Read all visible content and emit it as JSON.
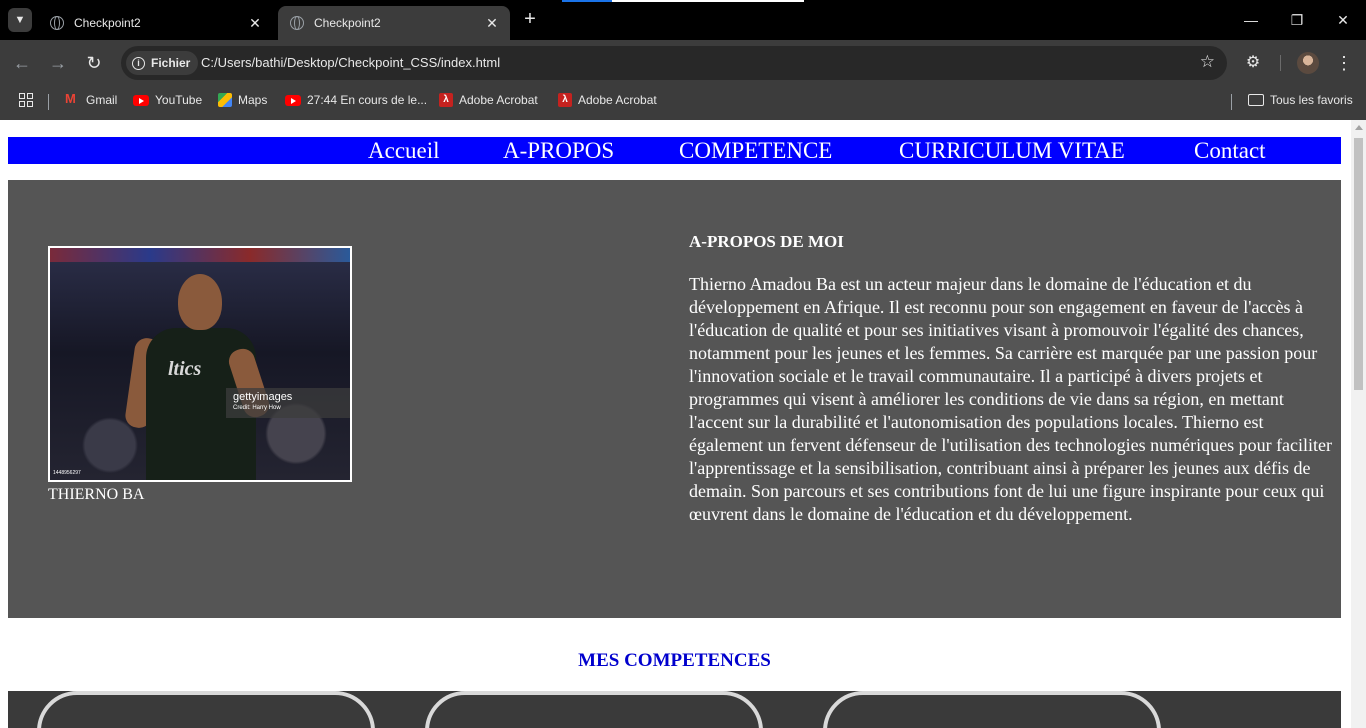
{
  "browser": {
    "tabs": [
      {
        "title": "Checkpoint2"
      },
      {
        "title": "Checkpoint2"
      }
    ],
    "site_chip": "Fichier",
    "url": "C:/Users/bathi/Desktop/Checkpoint_CSS/index.html",
    "bookmarks": [
      {
        "label": "Gmail"
      },
      {
        "label": "YouTube"
      },
      {
        "label": "Maps"
      },
      {
        "label": "27:44 En cours de le..."
      },
      {
        "label": "Adobe Acrobat"
      },
      {
        "label": "Adobe Acrobat"
      }
    ],
    "all_bookmarks": "Tous les favoris"
  },
  "page": {
    "nav": [
      "Accueil",
      "A-PROPOS",
      "COMPETENCE",
      "CURRICULUM VITAE",
      "Contact"
    ],
    "about": {
      "photo_watermark": "gettyimages",
      "photo_credit": "Credit: Harry How",
      "photo_id": "1448956297",
      "jersey_text": "ltics",
      "caption": "THIERNO BA",
      "heading": "A-PROPOS DE MOI",
      "text": "Thierno Amadou Ba est un acteur majeur dans le domaine de l'éducation et du développement en Afrique. Il est reconnu pour son engagement en faveur de l'accès à l'éducation de qualité et pour ses initiatives visant à promouvoir l'égalité des chances, notamment pour les jeunes et les femmes. Sa carrière est marquée par une passion pour l'innovation sociale et le travail communautaire. Il a participé à divers projets et programmes qui visent à améliorer les conditions de vie dans sa région, en mettant l'accent sur la durabilité et l'autonomisation des populations locales. Thierno est également un fervent défenseur de l'utilisation des technologies numériques pour faciliter l'apprentissage et la sensibilisation, contribuant ainsi à préparer les jeunes aux défis de demain. Son parcours et ses contributions font de lui une figure inspirante pour ceux qui œuvrent dans le domaine de l'éducation et du développement."
    },
    "skills_title": "MES COMPETENCES"
  },
  "colors": {
    "nav_bg": "#0000ff",
    "about_bg": "#555555",
    "skills_title": "#0000cd",
    "browser_dark": "#3c3c3c"
  }
}
